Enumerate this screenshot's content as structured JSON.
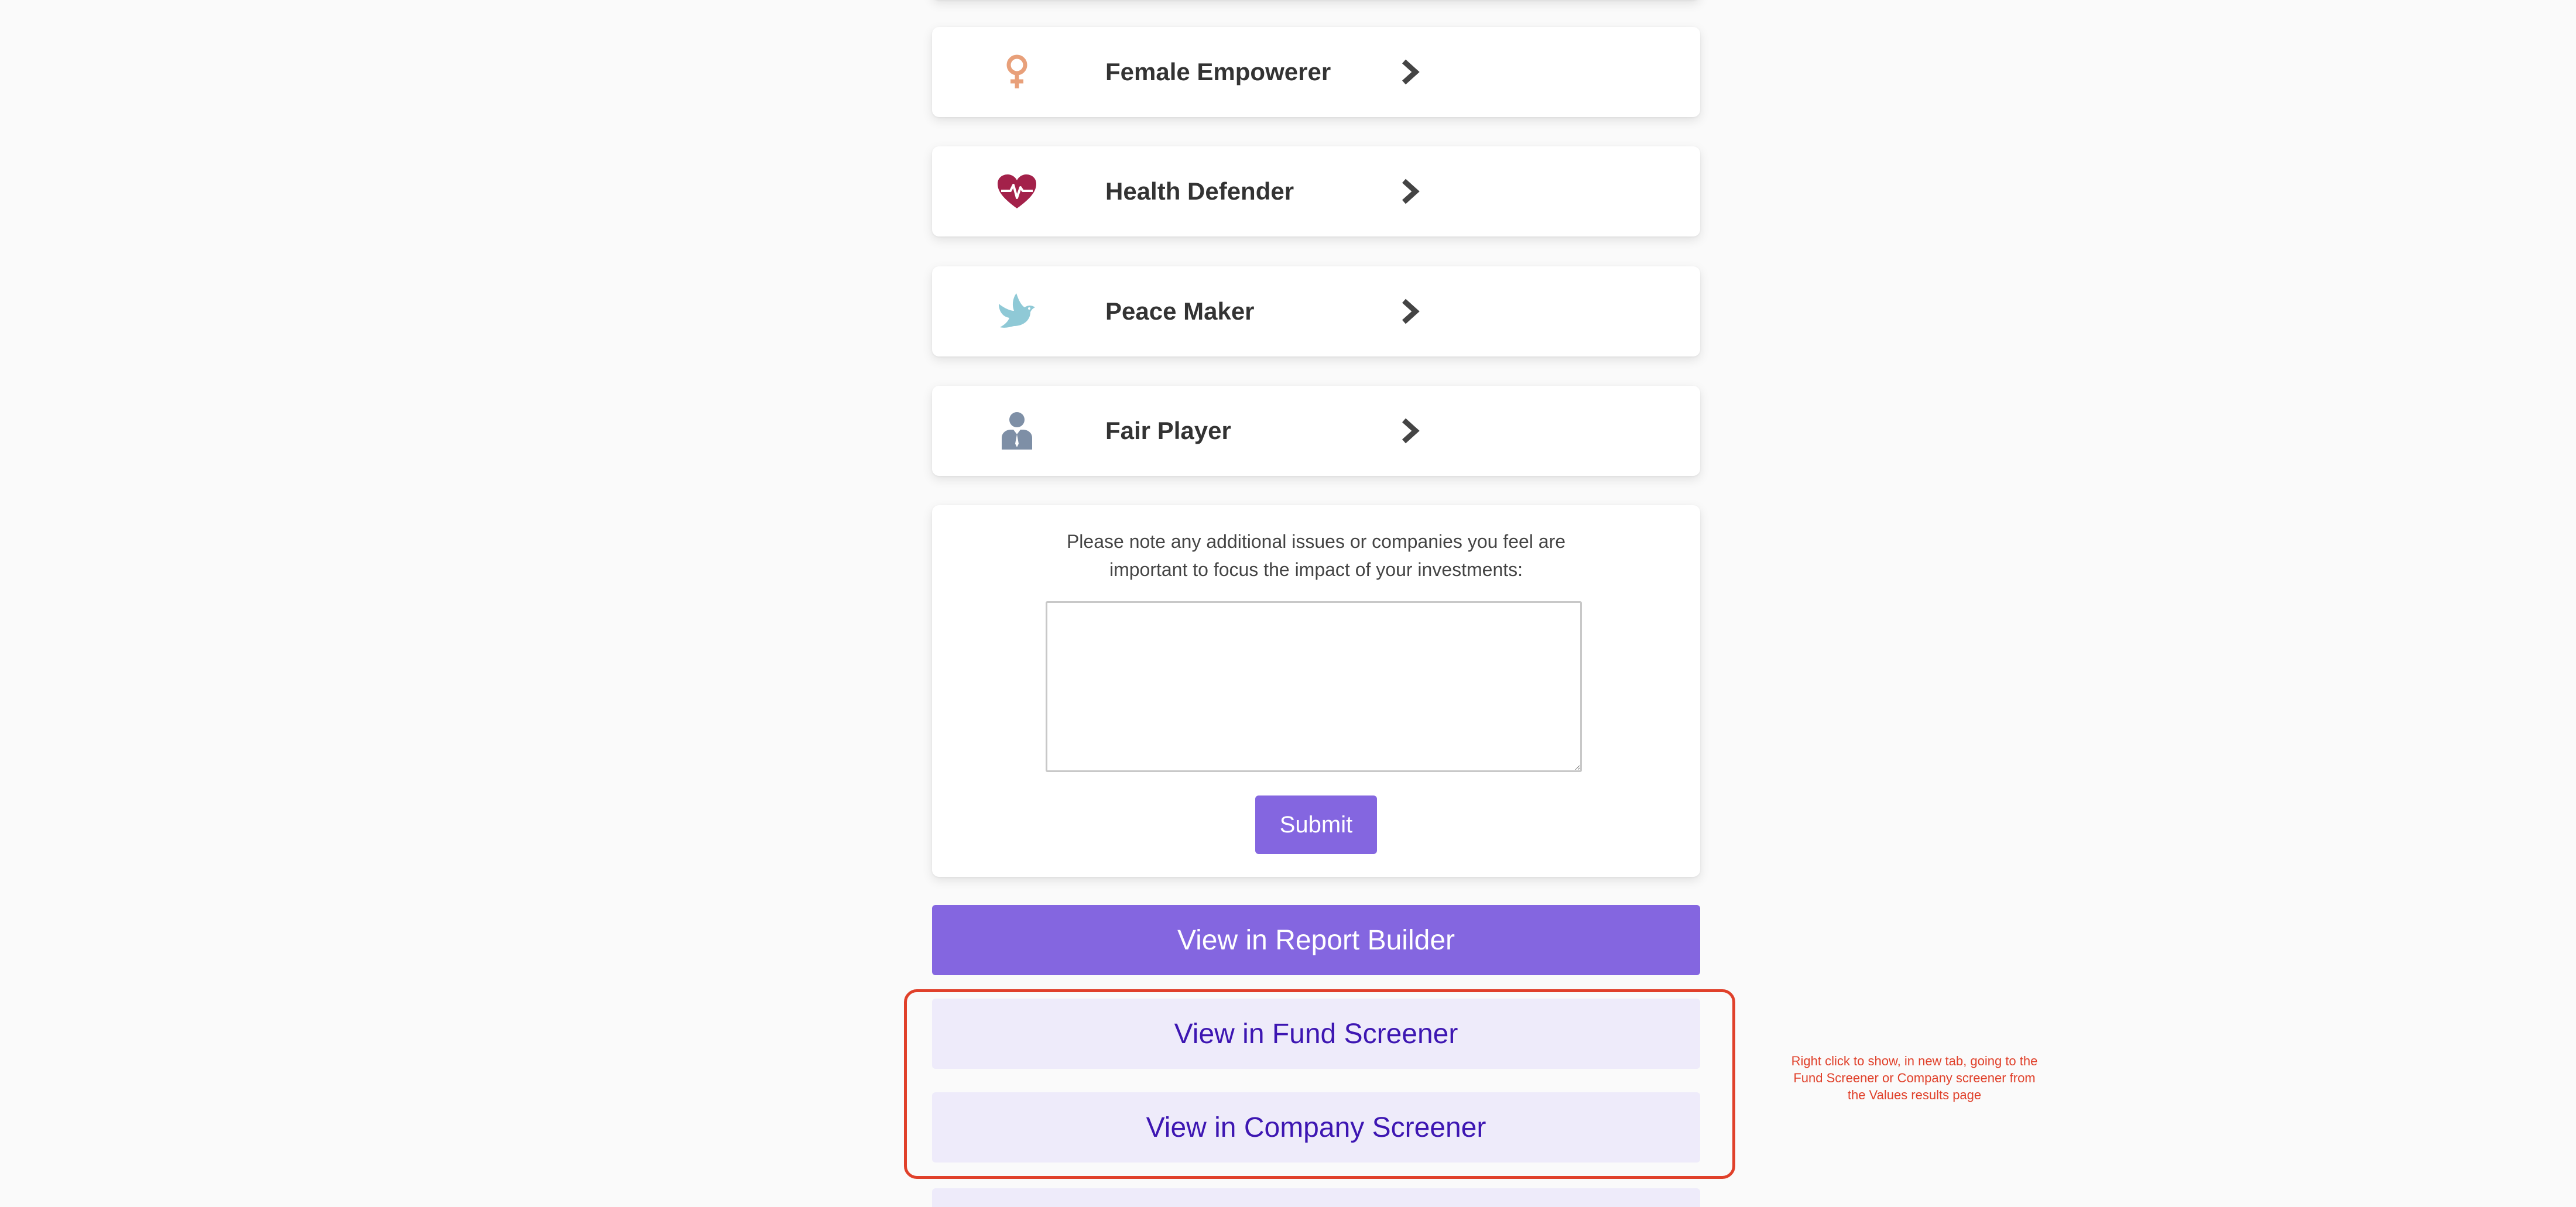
{
  "values_list": [
    {
      "label": "Female Empowerer",
      "icon": "female-symbol-icon",
      "icon_color": "#e8a07a"
    },
    {
      "label": "Health Defender",
      "icon": "heartbeat-icon",
      "icon_color": "#a3214a"
    },
    {
      "label": "Peace Maker",
      "icon": "dove-icon",
      "icon_color": "#8fc9d6"
    },
    {
      "label": "Fair Player",
      "icon": "businessman-icon",
      "icon_color": "#7e8fa6"
    }
  ],
  "notes": {
    "prompt": "Please note any additional issues or companies you feel are important to focus the impact of your investments:",
    "textarea_value": "",
    "submit_label": "Submit"
  },
  "actions": {
    "report_builder_label": "View in Report Builder",
    "fund_screener_label": "View in Fund Screener",
    "company_screener_label": "View in Company Screener"
  },
  "annotation": {
    "text": "Right click to show, in new tab, going to the Fund Screener or Company screener from the Values results page",
    "color": "#e0402a"
  },
  "colors": {
    "accent": "#8466e0",
    "secondary_bg": "#eeebfa",
    "secondary_text": "#3d16b2",
    "chevron": "#444444"
  }
}
